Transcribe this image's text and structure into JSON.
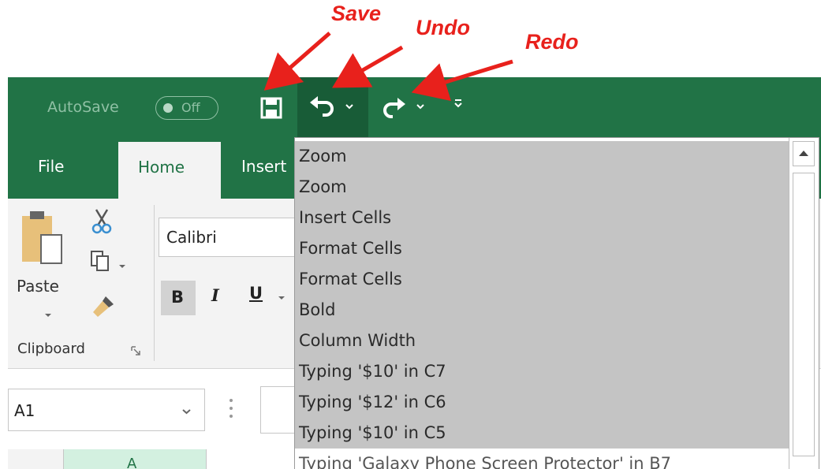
{
  "annotations": {
    "save": "Save",
    "undo": "Undo",
    "redo": "Redo",
    "color": "#e8211c"
  },
  "titlebar": {
    "autosave_label": "AutoSave",
    "autosave_state": "Off",
    "color": "#217346"
  },
  "tabs": {
    "file": "File",
    "home": "Home",
    "insert": "Insert"
  },
  "ribbon": {
    "paste_label": "Paste",
    "clipboard_group": "Clipboard",
    "font_name": "Calibri",
    "bold": "B",
    "italic": "I",
    "underline": "U"
  },
  "formula_bar": {
    "name_box": "A1"
  },
  "grid": {
    "column_a": "A"
  },
  "undo_history": {
    "items": [
      "Zoom",
      "Zoom",
      "Insert Cells",
      "Format Cells",
      "Format Cells",
      "Bold",
      "Column Width",
      "Typing '$10' in C7",
      "Typing '$12' in C6",
      "Typing '$10' in C5",
      "Typing 'Galaxy Phone Screen Protector' in B7"
    ]
  },
  "icons": [
    "save-icon",
    "undo-icon",
    "redo-icon",
    "customize-qat-icon",
    "paste-icon",
    "cut-icon",
    "copy-icon",
    "format-painter-icon",
    "dialog-launcher-icon",
    "chevron-down-icon",
    "scroll-up-icon"
  ]
}
